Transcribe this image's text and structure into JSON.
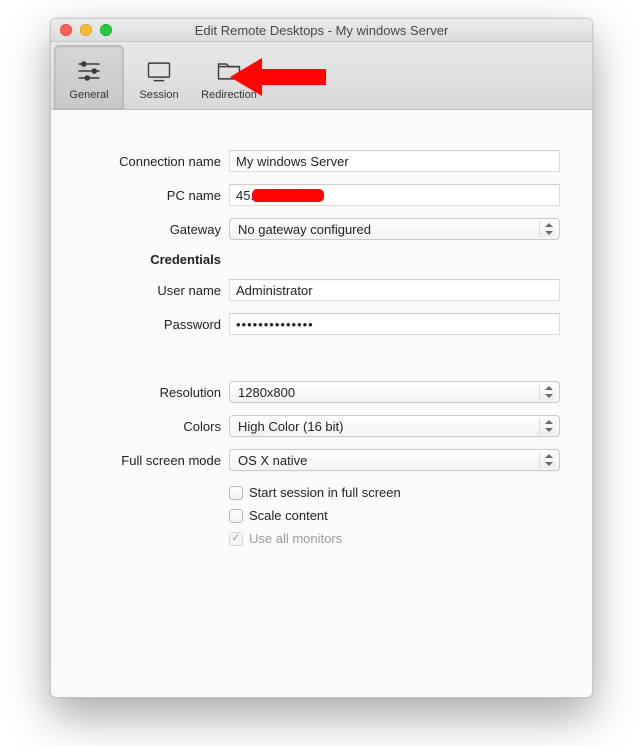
{
  "window": {
    "title": "Edit Remote Desktops - My windows Server"
  },
  "toolbar": {
    "general": "General",
    "session": "Session",
    "redirection": "Redirection"
  },
  "labels": {
    "connection_name": "Connection name",
    "pc_name": "PC name",
    "gateway": "Gateway",
    "credentials": "Credentials",
    "user_name": "User name",
    "password": "Password",
    "resolution": "Resolution",
    "colors": "Colors",
    "full_screen_mode": "Full screen mode"
  },
  "values": {
    "connection_name": "My windows Server",
    "pc_name": "45.",
    "gateway": "No gateway configured",
    "user_name": "Administrator",
    "password": "••••••••••••••",
    "resolution": "1280x800",
    "colors": "High Color (16 bit)",
    "full_screen_mode": "OS X native"
  },
  "checkboxes": {
    "start_full_screen": "Start session in full screen",
    "scale_content": "Scale content",
    "use_all_monitors": "Use all monitors"
  }
}
